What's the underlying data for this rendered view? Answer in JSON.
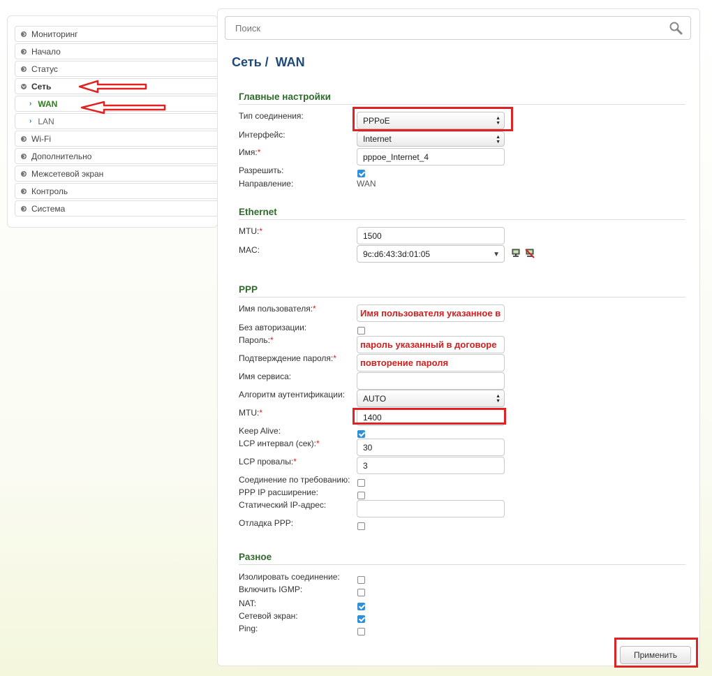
{
  "sidebar": {
    "items": [
      {
        "label": "Мониторинг"
      },
      {
        "label": "Начало"
      },
      {
        "label": "Статус"
      },
      {
        "label": "Сеть"
      },
      {
        "label": "WAN"
      },
      {
        "label": "LAN"
      },
      {
        "label": "Wi-Fi"
      },
      {
        "label": "Дополнительно"
      },
      {
        "label": "Межсетевой экран"
      },
      {
        "label": "Контроль"
      },
      {
        "label": "Система"
      }
    ]
  },
  "search": {
    "placeholder": "Поиск",
    "icon": "search-icon"
  },
  "page": {
    "breadcrumb_section": "Сеть /",
    "breadcrumb_page": "WAN"
  },
  "main_settings": {
    "title": "Главные настройки",
    "connection_type_label": "Тип соединения:",
    "connection_type_value": "PPPoE",
    "interface_label": "Интерфейс:",
    "interface_value": "Internet",
    "name_label": "Имя:",
    "name_value": "pppoe_Internet_4",
    "enable_label": "Разрешить:",
    "enable_checked": true,
    "direction_label": "Направление:",
    "direction_value": "WAN"
  },
  "ethernet": {
    "title": "Ethernet",
    "mtu_label": "MTU:",
    "mtu_value": "1500",
    "mac_label": "MAC:",
    "mac_value": "9c:d6:43:3d:01:05"
  },
  "ppp": {
    "title": "PPP",
    "username_label": "Имя пользователя:",
    "username_hint": "Имя пользователя указанное в договоре",
    "no_auth_label": "Без авторизации:",
    "no_auth_checked": false,
    "password_label": "Пароль:",
    "password_hint": "пароль указанный в договоре",
    "password_confirm_label": "Подтверждение пароля:",
    "password_confirm_hint": "повторение пароля",
    "service_name_label": "Имя сервиса:",
    "service_name_value": "",
    "auth_algo_label": "Алгоритм аутентификации:",
    "auth_algo_value": "AUTO",
    "mtu_label": "MTU:",
    "mtu_value": "1400",
    "keep_alive_label": "Keep Alive:",
    "keep_alive_checked": true,
    "lcp_interval_label": "LCP интервал (сек):",
    "lcp_interval_value": "30",
    "lcp_fails_label": "LCP провалы:",
    "lcp_fails_value": "3",
    "on_demand_label": "Соединение по требованию:",
    "on_demand_checked": false,
    "ppp_ip_ext_label": "PPP IP расширение:",
    "ppp_ip_ext_checked": false,
    "static_ip_label": "Статический IP-адрес:",
    "static_ip_value": "",
    "debug_label": "Отладка PPP:",
    "debug_checked": false
  },
  "misc": {
    "title": "Разное",
    "isolate_label": "Изолировать соединение:",
    "isolate_checked": false,
    "igmp_label": "Включить IGMP:",
    "igmp_checked": false,
    "nat_label": "NAT:",
    "nat_checked": true,
    "firewall_label": "Сетевой экран:",
    "firewall_checked": true,
    "ping_label": "Ping:",
    "ping_checked": false
  },
  "actions": {
    "apply_label": "Применить"
  },
  "colors": {
    "annotation_red": "#e12222",
    "section_green": "#2e6b2a",
    "title_blue": "#1d4a7a",
    "checkbox_blue": "#2f8fd8"
  }
}
